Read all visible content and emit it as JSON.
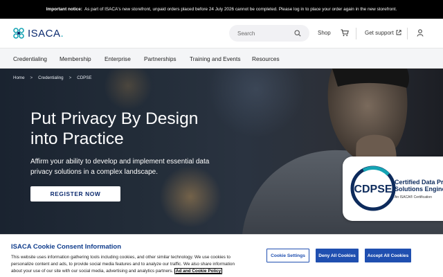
{
  "notice": {
    "label": "Important notice:",
    "text": "As part of ISACA's new storefront, unpaid orders placed before 24 July 2026 cannot be completed. Please log in to place your order again in the new storefront."
  },
  "header": {
    "logo_text": "ISACA",
    "logo_dot": ".",
    "search_placeholder": "Search",
    "shop_label": "Shop",
    "support_label": "Get support"
  },
  "nav": {
    "items": [
      "Credentialing",
      "Membership",
      "Enterprise",
      "Partnerships",
      "Training and Events",
      "Resources"
    ]
  },
  "hero": {
    "breadcrumb": [
      "Home",
      "Credentialing",
      "CDPSE"
    ],
    "breadcrumb_separator": ">",
    "title_line1": "Put Privacy By Design",
    "title_line2": "into Practice",
    "subtitle": "Affirm your ability to develop and implement essential data privacy solutions in a complex landscape.",
    "cta_label": "REGISTER NOW",
    "badge": {
      "ring_text": "CDPSE",
      "title_line1": "Certified Data Pr",
      "title_line2": "Solutions Engine",
      "subtitle": "An ISACA® Certification"
    }
  },
  "cookie": {
    "title": "ISACA Cookie Consent Information",
    "text": "This website uses information gathering tools including cookies, and other similar technology. We use cookies to personalize content and ads, to provide social media features and to analyze our traffic. We also share information about your use of our site with our social media, advertising and analytics partners.",
    "link_label": "Ad and Cookie Policy",
    "settings_label": "Cookie Settings",
    "deny_label": "Deny All Cookies",
    "accept_label": "Accept All Cookies"
  },
  "colors": {
    "brand_navy": "#0b2a6e",
    "brand_teal": "#15a4b4",
    "cookie_blue": "#1f4fb0",
    "notice_bg": "#000000"
  },
  "icons": [
    "isaca-logo-icon",
    "search-icon",
    "cart-icon",
    "external-link-icon",
    "user-icon",
    "chevron-right-icon"
  ]
}
